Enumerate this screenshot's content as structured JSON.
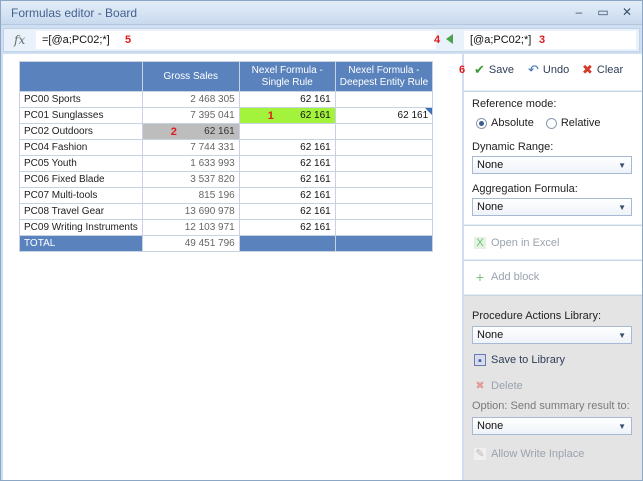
{
  "window": {
    "title": "Formulas editor - Board"
  },
  "formula_bar": {
    "fx_label": "fx",
    "formula_value": "=[@a;PC02;*]",
    "right_value": "[@a;PC02;*]",
    "markers": {
      "m5": "5",
      "m4": "4",
      "m3": "3"
    }
  },
  "grid": {
    "headers": {
      "gross_sales": "Gross Sales",
      "single_rule_1": "Nexel Formula -",
      "single_rule_2": "Single Rule",
      "deepest_1": "Nexel Formula -",
      "deepest_2": "Deepest Entity Rule"
    },
    "rows": [
      {
        "name": "PC00 Sports",
        "gross_sales": "2 468 305",
        "single_rule": "62 161",
        "deepest": ""
      },
      {
        "name": "PC01 Sunglasses",
        "gross_sales": "7 395 041",
        "single_rule": "62 161",
        "deepest": "62 161"
      },
      {
        "name": "PC02 Outdoors",
        "gross_sales": "62 161",
        "single_rule": "",
        "deepest": ""
      },
      {
        "name": "PC04 Fashion",
        "gross_sales": "7 744 331",
        "single_rule": "62 161",
        "deepest": ""
      },
      {
        "name": "PC05 Youth",
        "gross_sales": "1 633 993",
        "single_rule": "62 161",
        "deepest": ""
      },
      {
        "name": "PC06 Fixed Blade",
        "gross_sales": "3 537 820",
        "single_rule": "62 161",
        "deepest": ""
      },
      {
        "name": "PC07 Multi-tools",
        "gross_sales": "815 196",
        "single_rule": "62 161",
        "deepest": ""
      },
      {
        "name": "PC08 Travel Gear",
        "gross_sales": "13 690 978",
        "single_rule": "62 161",
        "deepest": ""
      },
      {
        "name": "PC09 Writing Instruments",
        "gross_sales": "12 103 971",
        "single_rule": "62 161",
        "deepest": ""
      }
    ],
    "total": {
      "name": "TOTAL",
      "gross_sales": "49 451 796"
    },
    "markers": {
      "m1": "1",
      "m2": "2"
    }
  },
  "panel": {
    "toolbar": {
      "save": "Save",
      "undo": "Undo",
      "clear": "Clear",
      "marker": "6"
    },
    "reference_mode": {
      "label": "Reference mode:",
      "absolute": "Absolute",
      "relative": "Relative",
      "selected": "Absolute"
    },
    "dynamic_range": {
      "label": "Dynamic Range:",
      "value": "None"
    },
    "aggregation": {
      "label": "Aggregation Formula:",
      "value": "None"
    },
    "open_excel": "Open in Excel",
    "add_block": "Add block",
    "procedure_library": {
      "label": "Procedure Actions Library:",
      "value": "None"
    },
    "save_library": "Save to Library",
    "delete": "Delete",
    "summary": {
      "label": "Option: Send summary result to:",
      "value": "None"
    },
    "allow_write": "Allow Write Inplace"
  },
  "colors": {
    "header_blue": "#5a83bd",
    "selected_green": "#a3f23c",
    "selected_grey": "#bdbdbd",
    "marker_red": "#e01b1b"
  }
}
